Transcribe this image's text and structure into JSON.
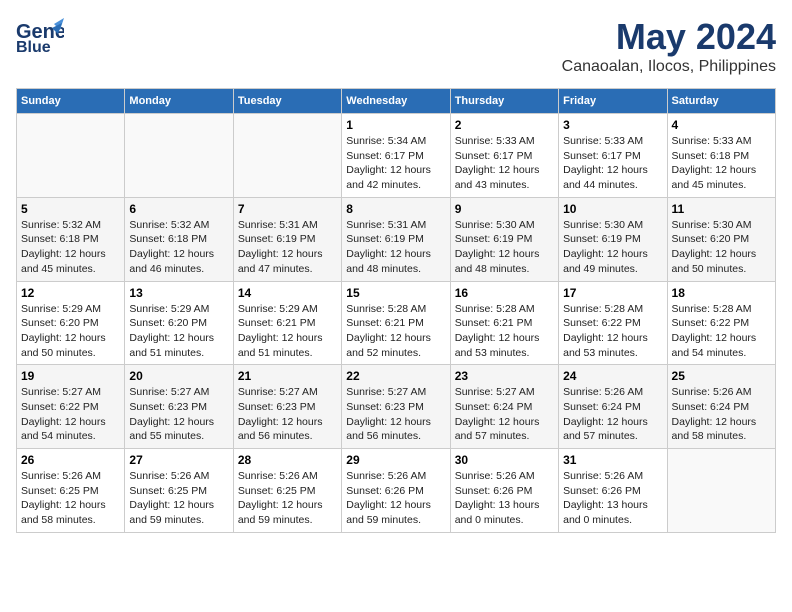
{
  "logo": {
    "line1": "General",
    "line2": "Blue"
  },
  "title": "May 2024",
  "subtitle": "Canaoalan, Ilocos, Philippines",
  "days_of_week": [
    "Sunday",
    "Monday",
    "Tuesday",
    "Wednesday",
    "Thursday",
    "Friday",
    "Saturday"
  ],
  "weeks": [
    [
      {
        "num": "",
        "text": ""
      },
      {
        "num": "",
        "text": ""
      },
      {
        "num": "",
        "text": ""
      },
      {
        "num": "1",
        "text": "Sunrise: 5:34 AM\nSunset: 6:17 PM\nDaylight: 12 hours\nand 42 minutes."
      },
      {
        "num": "2",
        "text": "Sunrise: 5:33 AM\nSunset: 6:17 PM\nDaylight: 12 hours\nand 43 minutes."
      },
      {
        "num": "3",
        "text": "Sunrise: 5:33 AM\nSunset: 6:17 PM\nDaylight: 12 hours\nand 44 minutes."
      },
      {
        "num": "4",
        "text": "Sunrise: 5:33 AM\nSunset: 6:18 PM\nDaylight: 12 hours\nand 45 minutes."
      }
    ],
    [
      {
        "num": "5",
        "text": "Sunrise: 5:32 AM\nSunset: 6:18 PM\nDaylight: 12 hours\nand 45 minutes."
      },
      {
        "num": "6",
        "text": "Sunrise: 5:32 AM\nSunset: 6:18 PM\nDaylight: 12 hours\nand 46 minutes."
      },
      {
        "num": "7",
        "text": "Sunrise: 5:31 AM\nSunset: 6:19 PM\nDaylight: 12 hours\nand 47 minutes."
      },
      {
        "num": "8",
        "text": "Sunrise: 5:31 AM\nSunset: 6:19 PM\nDaylight: 12 hours\nand 48 minutes."
      },
      {
        "num": "9",
        "text": "Sunrise: 5:30 AM\nSunset: 6:19 PM\nDaylight: 12 hours\nand 48 minutes."
      },
      {
        "num": "10",
        "text": "Sunrise: 5:30 AM\nSunset: 6:19 PM\nDaylight: 12 hours\nand 49 minutes."
      },
      {
        "num": "11",
        "text": "Sunrise: 5:30 AM\nSunset: 6:20 PM\nDaylight: 12 hours\nand 50 minutes."
      }
    ],
    [
      {
        "num": "12",
        "text": "Sunrise: 5:29 AM\nSunset: 6:20 PM\nDaylight: 12 hours\nand 50 minutes."
      },
      {
        "num": "13",
        "text": "Sunrise: 5:29 AM\nSunset: 6:20 PM\nDaylight: 12 hours\nand 51 minutes."
      },
      {
        "num": "14",
        "text": "Sunrise: 5:29 AM\nSunset: 6:21 PM\nDaylight: 12 hours\nand 51 minutes."
      },
      {
        "num": "15",
        "text": "Sunrise: 5:28 AM\nSunset: 6:21 PM\nDaylight: 12 hours\nand 52 minutes."
      },
      {
        "num": "16",
        "text": "Sunrise: 5:28 AM\nSunset: 6:21 PM\nDaylight: 12 hours\nand 53 minutes."
      },
      {
        "num": "17",
        "text": "Sunrise: 5:28 AM\nSunset: 6:22 PM\nDaylight: 12 hours\nand 53 minutes."
      },
      {
        "num": "18",
        "text": "Sunrise: 5:28 AM\nSunset: 6:22 PM\nDaylight: 12 hours\nand 54 minutes."
      }
    ],
    [
      {
        "num": "19",
        "text": "Sunrise: 5:27 AM\nSunset: 6:22 PM\nDaylight: 12 hours\nand 54 minutes."
      },
      {
        "num": "20",
        "text": "Sunrise: 5:27 AM\nSunset: 6:23 PM\nDaylight: 12 hours\nand 55 minutes."
      },
      {
        "num": "21",
        "text": "Sunrise: 5:27 AM\nSunset: 6:23 PM\nDaylight: 12 hours\nand 56 minutes."
      },
      {
        "num": "22",
        "text": "Sunrise: 5:27 AM\nSunset: 6:23 PM\nDaylight: 12 hours\nand 56 minutes."
      },
      {
        "num": "23",
        "text": "Sunrise: 5:27 AM\nSunset: 6:24 PM\nDaylight: 12 hours\nand 57 minutes."
      },
      {
        "num": "24",
        "text": "Sunrise: 5:26 AM\nSunset: 6:24 PM\nDaylight: 12 hours\nand 57 minutes."
      },
      {
        "num": "25",
        "text": "Sunrise: 5:26 AM\nSunset: 6:24 PM\nDaylight: 12 hours\nand 58 minutes."
      }
    ],
    [
      {
        "num": "26",
        "text": "Sunrise: 5:26 AM\nSunset: 6:25 PM\nDaylight: 12 hours\nand 58 minutes."
      },
      {
        "num": "27",
        "text": "Sunrise: 5:26 AM\nSunset: 6:25 PM\nDaylight: 12 hours\nand 59 minutes."
      },
      {
        "num": "28",
        "text": "Sunrise: 5:26 AM\nSunset: 6:25 PM\nDaylight: 12 hours\nand 59 minutes."
      },
      {
        "num": "29",
        "text": "Sunrise: 5:26 AM\nSunset: 6:26 PM\nDaylight: 12 hours\nand 59 minutes."
      },
      {
        "num": "30",
        "text": "Sunrise: 5:26 AM\nSunset: 6:26 PM\nDaylight: 13 hours\nand 0 minutes."
      },
      {
        "num": "31",
        "text": "Sunrise: 5:26 AM\nSunset: 6:26 PM\nDaylight: 13 hours\nand 0 minutes."
      },
      {
        "num": "",
        "text": ""
      }
    ]
  ]
}
